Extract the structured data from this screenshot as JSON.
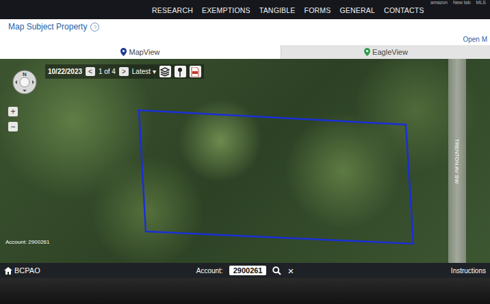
{
  "browser_bookmarks": [
    "amazon",
    "New tab",
    "MLS"
  ],
  "nav": {
    "items": [
      "RESEARCH",
      "EXEMPTIONS",
      "TANGIBLE",
      "FORMS",
      "GENERAL",
      "CONTACTS"
    ]
  },
  "header": {
    "title": "Map Subject Property",
    "help_icon": "?",
    "open_link": "Open M"
  },
  "tabs": [
    {
      "label": "MapView",
      "selected": true,
      "color": "#1f3a93"
    },
    {
      "label": "EagleView",
      "selected": false,
      "color": "#2e9e4f"
    }
  ],
  "map_toolbar": {
    "date": "10/22/2023",
    "prev": "<",
    "page": "1 of 4",
    "next": ">",
    "version": "Latest ▾"
  },
  "map": {
    "compass": "N",
    "zoom_in": "+",
    "zoom_out": "−",
    "street_label": "TRENTON AV SW",
    "account_label": "Account: 2900261"
  },
  "footer": {
    "brand": "BCPAO",
    "account_label": "Account:",
    "account_value": "2900261",
    "clear": "×",
    "link": "Instructions"
  }
}
